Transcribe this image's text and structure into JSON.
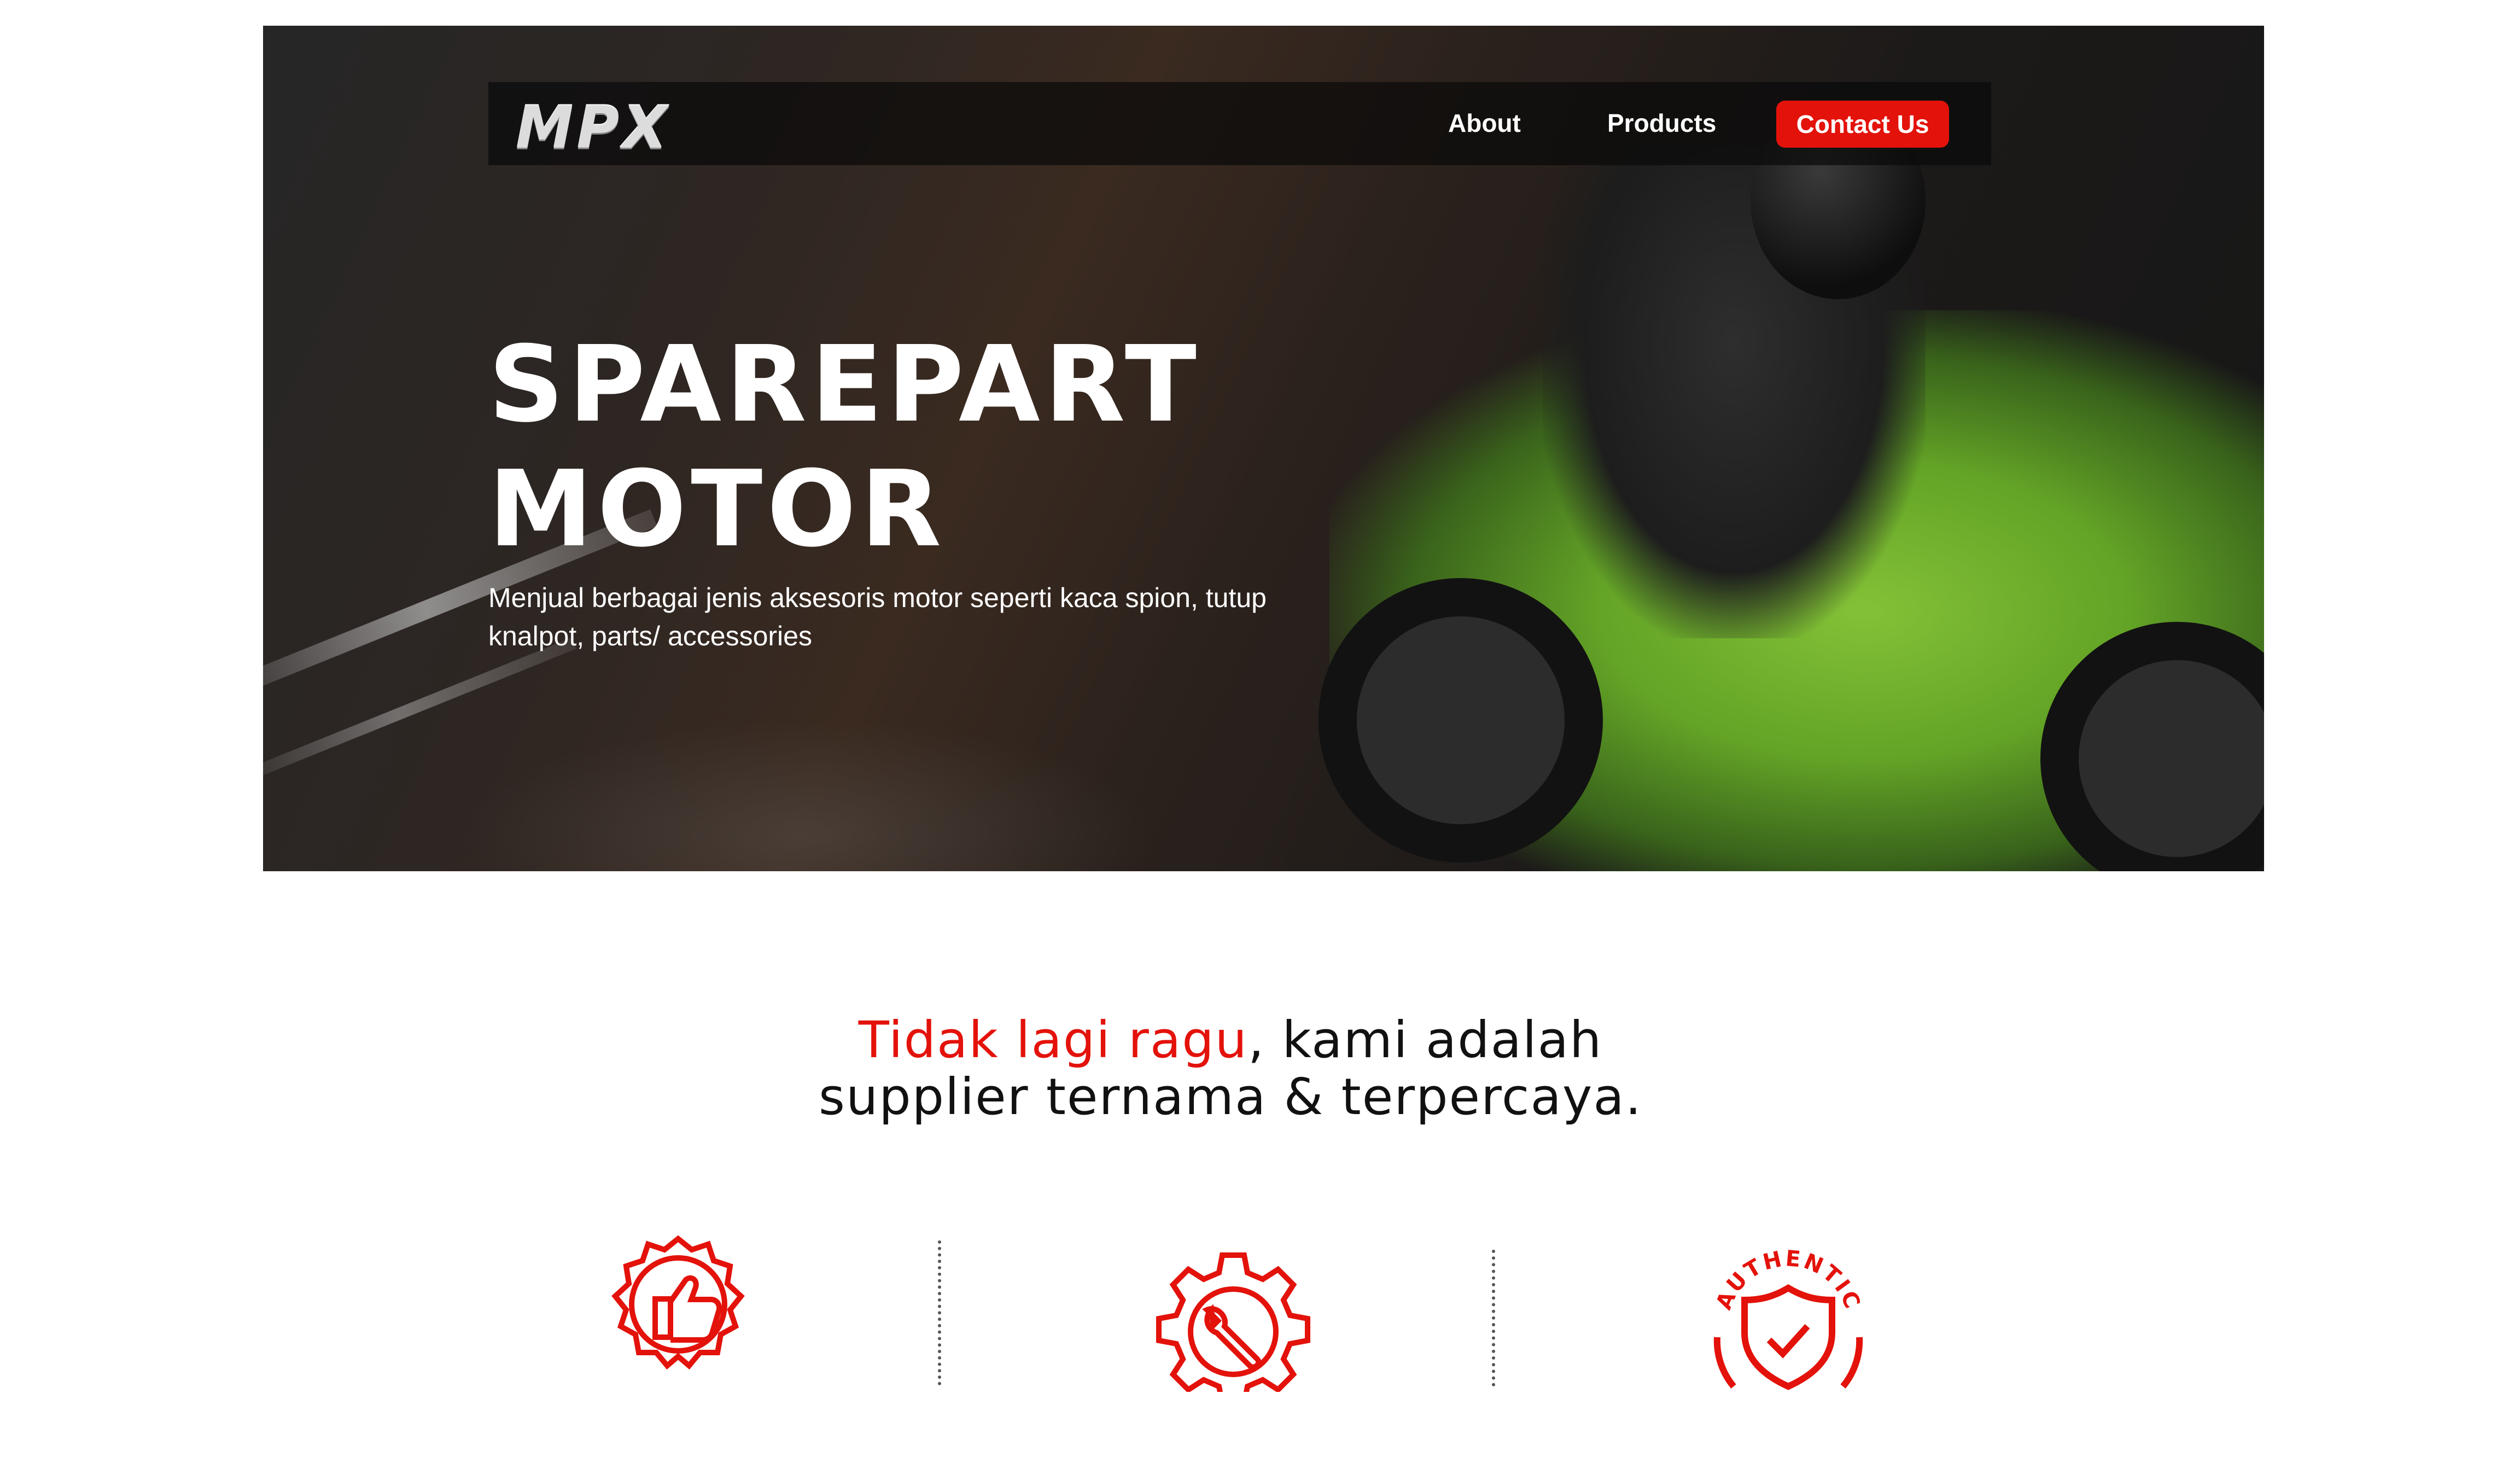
{
  "navbar": {
    "logo": "MPX",
    "links": [
      "About",
      "Products"
    ],
    "contact_label": "Contact Us"
  },
  "hero": {
    "title_line1": "SPAREPART",
    "title_line2": "MOTOR",
    "description": "Menjual berbagai jenis aksesoris motor seperti kaca spion, tutup knalpot, parts/ accessories"
  },
  "tagline": {
    "highlight": "Tidak lagi ragu",
    "rest_line1": ", kami adalah",
    "line2": "supplier ternama & terpercaya."
  },
  "features": {
    "icons": [
      "thumbs-up-badge-icon",
      "gear-wrench-icon",
      "authentic-shield-icon"
    ],
    "authentic_text": "AUTHENTIC"
  },
  "colors": {
    "accent": "#e3120b",
    "text_dark": "#111111",
    "nav_bg": "#0a0a0a"
  }
}
